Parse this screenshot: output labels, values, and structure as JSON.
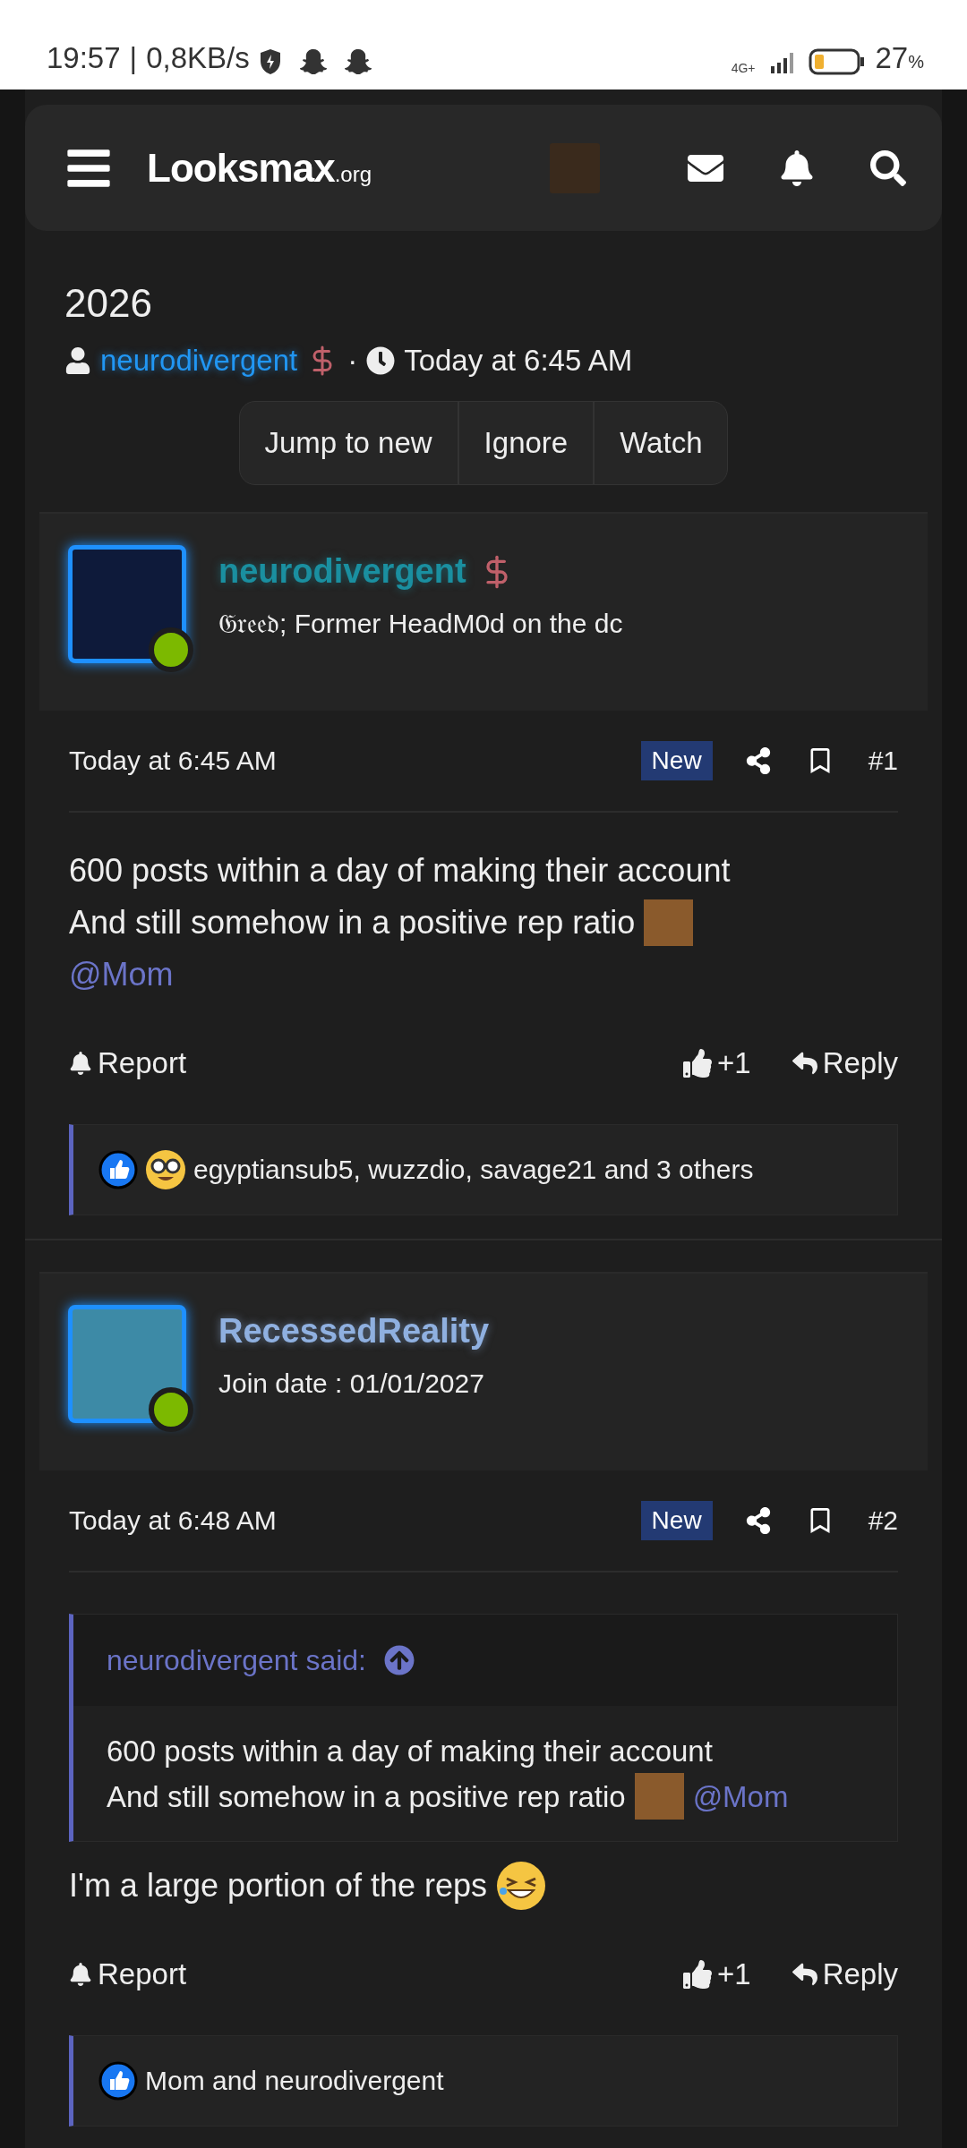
{
  "status_bar": {
    "time": "19:57",
    "divider": "|",
    "speed": "0,8KB/s",
    "network": "4G+",
    "battery_percent": "27",
    "percent_sign": "%"
  },
  "header": {
    "logo": "Looksmax",
    "logo_suffix": ".org"
  },
  "thread": {
    "title": "2026",
    "author": "neurodivergent",
    "separator": "·",
    "time": "Today at 6:45 AM",
    "buttons": [
      "Jump to new",
      "Ignore",
      "Watch"
    ]
  },
  "posts": [
    {
      "user": {
        "name": "neurodivergent",
        "color": "#1a8fa0",
        "banner": true,
        "subtitle": "𝔊𝔯𝔢𝔢𝔡; Former HeadM0d on the dc",
        "online": true
      },
      "time": "Today at 6:45 AM",
      "badge": "New",
      "number": "#1",
      "body": [
        [
          {
            "kind": "text",
            "text": "600 posts within a day of making their account"
          }
        ],
        [
          {
            "kind": "text",
            "text": "And still somehow in a positive rep ratio"
          },
          {
            "kind": "image"
          }
        ],
        [
          {
            "kind": "mention",
            "text": "@Mom"
          }
        ]
      ],
      "actions": {
        "report": "Report",
        "likes": "+1",
        "reply": "Reply"
      },
      "reactions": {
        "icons": [
          {
            "kind": "like"
          },
          {
            "kind": "nerd"
          }
        ],
        "text": "egyptiansub5, wuzzdio, savage21 and 3 others"
      }
    },
    {
      "user": {
        "name": "RecessedReality",
        "color": "#8fb0e0",
        "banner": false,
        "subtitle": "Join date : 01/01/2027",
        "online": true
      },
      "time": "Today at 6:48 AM",
      "badge": "New",
      "number": "#2",
      "quote": {
        "author": "neurodivergent said:",
        "lines": [
          [
            {
              "kind": "text",
              "text": "600 posts within a day of making their account"
            }
          ],
          [
            {
              "kind": "text",
              "text": "And still somehow in a positive rep ratio"
            },
            {
              "kind": "image"
            },
            {
              "kind": "mention",
              "text": "@Mom"
            }
          ]
        ]
      },
      "body": [
        [
          {
            "kind": "text",
            "text": "I'm a large portion of the reps"
          },
          {
            "kind": "laughing"
          }
        ]
      ],
      "actions": {
        "report": "Report",
        "likes": "+1",
        "reply": "Reply"
      },
      "reactions": {
        "icons": [
          {
            "kind": "like"
          }
        ],
        "text": "Mom and neurodivergent"
      }
    }
  ]
}
